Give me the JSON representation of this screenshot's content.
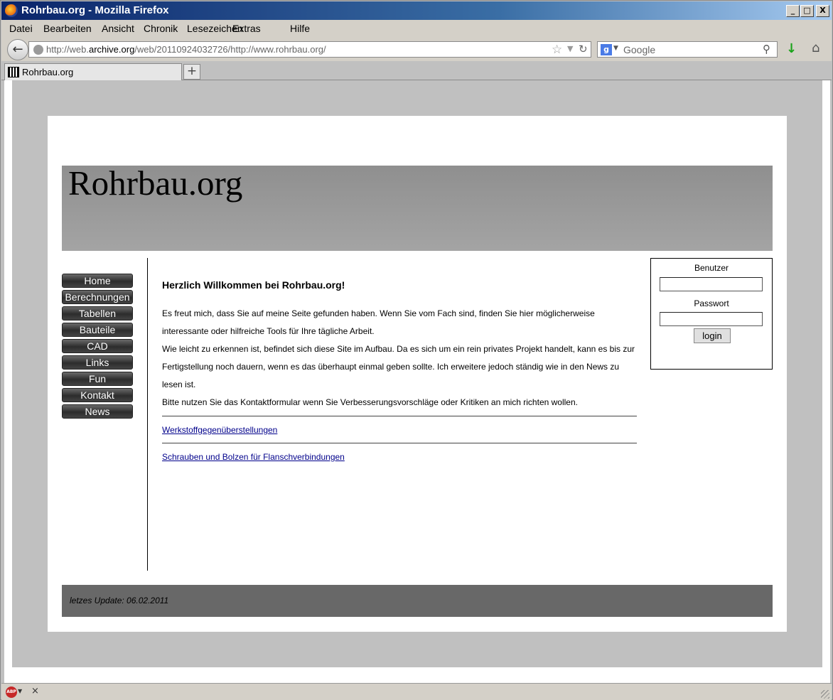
{
  "window": {
    "title": "Rohrbau.org - Mozilla Firefox",
    "min": "_",
    "max": "□",
    "close": "X"
  },
  "menu": [
    "Datei",
    "Bearbeiten",
    "Ansicht",
    "Chronik",
    "Lesezeichen",
    "Extras",
    "Hilfe"
  ],
  "nav": {
    "back": "←",
    "url_prefix": "http://web.",
    "url_host": "archive.org",
    "url_rest": "/web/20110924032726/http://www.rohrbau.org/",
    "star": "☆",
    "dropdown": "▼",
    "reload": "↻",
    "search_engine": "g",
    "search_dropdown": "▼",
    "search_placeholder": "Google",
    "magnifier": "⚲",
    "download": "↓",
    "home": "⌂"
  },
  "tabs": {
    "active_label": "Rohrbau.org",
    "new_tab": "+"
  },
  "site": {
    "title": "Rohrbau.org",
    "nav_items": [
      "Home",
      "Berechnungen",
      "Tabellen",
      "Bauteile",
      "CAD",
      "Links",
      "Fun",
      "Kontakt",
      "News"
    ],
    "welcome": "Herzlich Willkommen bei Rohrbau.org!",
    "paragraph_1": "Es freut mich, dass Sie auf meine Seite gefunden haben. Wenn Sie vom Fach sind, finden Sie hier möglicherweise interessante oder hilfreiche Tools für Ihre tägliche Arbeit.",
    "paragraph_2": "Wie leicht zu erkennen ist, befindet sich diese Site im Aufbau. Da es sich um ein rein privates Projekt handelt, kann es bis zur Fertigstellung noch dauern, wenn es das überhaupt einmal geben sollte. Ich erweitere jedoch ständig wie in den News zu lesen ist.",
    "paragraph_3": "Bitte nutzen Sie das Kontaktformular wenn Sie Verbesserungsvorschläge oder Kritiken an mich richten wollen.",
    "link_1": "Werkstoffgegenüberstellungen",
    "link_2": "Schrauben und Bolzen für Flanschverbindungen",
    "login": {
      "user_label": "Benutzer",
      "user_value": "",
      "password_label": "Passwort",
      "password_value": "",
      "button": "login"
    },
    "footer": "letzes Update: 06.02.2011"
  },
  "status": {
    "abp": "ABP",
    "abp_dropdown": "▼",
    "close": "×"
  }
}
